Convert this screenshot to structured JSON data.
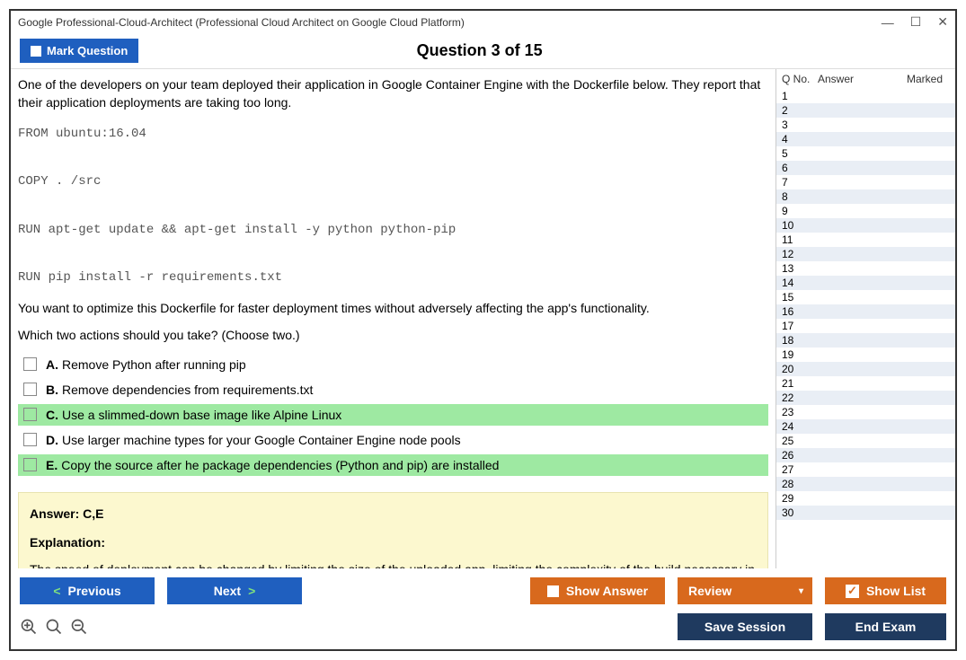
{
  "window": {
    "title": "Google Professional-Cloud-Architect (Professional Cloud Architect on Google Cloud Platform)"
  },
  "header": {
    "mark_label": "Mark Question",
    "question_counter": "Question 3 of 15"
  },
  "question": {
    "intro": "One of the developers on your team deployed their application in Google Container Engine with the Dockerfile below. They report that their application deployments are taking too long.",
    "code": "FROM ubuntu:16.04\n\nCOPY . /src\n\nRUN apt-get update && apt-get install -y python python-pip\n\nRUN pip install -r requirements.txt",
    "followup1": "You want to optimize this Dockerfile for faster deployment times without adversely affecting the app's functionality.",
    "followup2": "Which two actions should you take? (Choose two.)",
    "options": [
      {
        "letter": "A.",
        "text": "Remove Python after running pip",
        "correct": false
      },
      {
        "letter": "B.",
        "text": "Remove dependencies from requirements.txt",
        "correct": false
      },
      {
        "letter": "C.",
        "text": "Use a slimmed-down base image like Alpine Linux",
        "correct": true
      },
      {
        "letter": "D.",
        "text": "Use larger machine types for your Google Container Engine node pools",
        "correct": false
      },
      {
        "letter": "E.",
        "text": "Copy the source after he package dependencies (Python and pip) are installed",
        "correct": true
      }
    ],
    "answer_line": "Answer: C,E",
    "explanation_label": "Explanation:",
    "explanation_text": "The speed of deployment can be changed by limiting the size of the uploaded app, limiting the complexity of the build necessary in the Dockerfile, if present, and by ensuring a fast and reliable internet connection."
  },
  "sidebar": {
    "col_qno": "Q No.",
    "col_answer": "Answer",
    "col_marked": "Marked",
    "rows": [
      1,
      2,
      3,
      4,
      5,
      6,
      7,
      8,
      9,
      10,
      11,
      12,
      13,
      14,
      15,
      16,
      17,
      18,
      19,
      20,
      21,
      22,
      23,
      24,
      25,
      26,
      27,
      28,
      29,
      30
    ]
  },
  "footer": {
    "previous": "Previous",
    "next": "Next",
    "show_answer": "Show Answer",
    "review": "Review",
    "show_list": "Show List",
    "save_session": "Save Session",
    "end_exam": "End Exam"
  }
}
